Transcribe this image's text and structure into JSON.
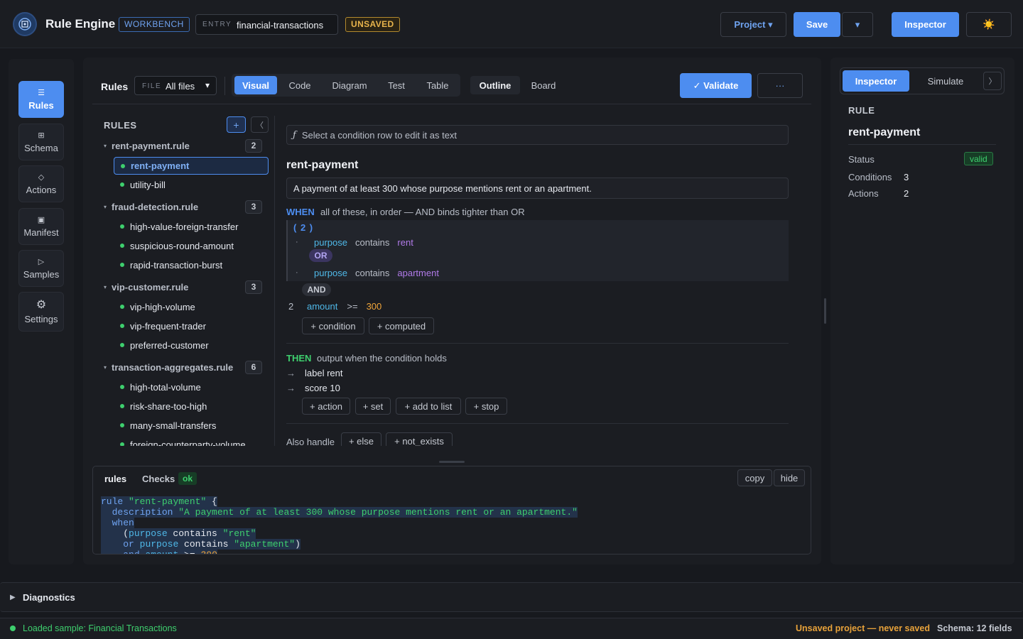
{
  "header": {
    "app_title": "Rule Engine",
    "workbench_badge": "WORKBENCH",
    "entry_label": "ENTRY",
    "entry_value": "financial-transactions",
    "unsaved_badge": "UNSAVED",
    "project_label": "Project ▾",
    "save_label": "Save",
    "save_menu_label": "▾",
    "inspector_label": "Inspector",
    "theme_icon": "☀️"
  },
  "nav": [
    {
      "icon": "☰",
      "label": "Rules"
    },
    {
      "icon": "⊞",
      "label": "Schema"
    },
    {
      "icon": "◇",
      "label": "Actions"
    },
    {
      "icon": "▣",
      "label": "Manifest"
    },
    {
      "icon": "▷",
      "label": "Samples"
    },
    {
      "icon": "⚙",
      "label": "Settings"
    }
  ],
  "toolbar": {
    "rules_label": "Rules",
    "file_label": "FILE",
    "file_value": "All files",
    "file_caret": "▾",
    "view_tabs": [
      "Visual",
      "Code",
      "Diagram",
      "Test",
      "Table"
    ],
    "layout_tabs": [
      "Outline",
      "Board"
    ],
    "validate_label": "✓ Validate",
    "more_label": "···"
  },
  "tree": {
    "title": "RULES",
    "add_label": "+",
    "collapse_label": "〈",
    "files": [
      {
        "name": "rent-payment.rule",
        "count": "2",
        "rules": [
          "rent-payment",
          "utility-bill"
        ]
      },
      {
        "name": "fraud-detection.rule",
        "count": "3",
        "rules": [
          "high-value-foreign-transfer",
          "suspicious-round-amount",
          "rapid-transaction-burst"
        ]
      },
      {
        "name": "vip-customer.rule",
        "count": "3",
        "rules": [
          "vip-high-volume",
          "vip-frequent-trader",
          "preferred-customer"
        ]
      },
      {
        "name": "transaction-aggregates.rule",
        "count": "6",
        "rules": [
          "high-total-volume",
          "risk-share-too-high",
          "many-small-transfers",
          "foreign-counterparty-volume"
        ]
      }
    ]
  },
  "editor": {
    "hint_icon": "ƒ",
    "hint": "Select a condition row to edit it as text",
    "rule_name": "rent-payment",
    "description": "A payment of at least 300 whose purpose mentions rent or an apartment.",
    "when_kw": "WHEN",
    "when_note": "all of these, in order — AND binds tighter than OR",
    "group_label": "( 2 )",
    "group_conditions": [
      {
        "field": "purpose",
        "op": "contains",
        "value": "rent"
      },
      {
        "field": "purpose",
        "op": "contains",
        "value": "apartment"
      }
    ],
    "or_label": "OR",
    "and_label": "AND",
    "cond2": {
      "num": "2",
      "field": "amount",
      "op": ">=",
      "value": "300"
    },
    "add_condition": "+ condition",
    "add_computed": "+ computed",
    "then_kw": "THEN",
    "then_note": "output when the condition holds",
    "actions": [
      {
        "arrow": "→",
        "text": "label rent"
      },
      {
        "arrow": "→",
        "text": "score 10"
      }
    ],
    "action_chips": [
      "+ action",
      "+ set",
      "+ add to list",
      "+ stop"
    ],
    "also_label": "Also handle",
    "also_chips": [
      "+ else",
      "+ not_exists"
    ]
  },
  "code_panel": {
    "tab_rules": "rules",
    "tab_checks": "Checks",
    "checks_badge": "ok",
    "copy_label": "copy",
    "hide_label": "hide"
  },
  "inspector": {
    "tab_inspector": "Inspector",
    "tab_simulate": "Simulate",
    "chevron": "〉",
    "section_label": "RULE",
    "rule_name": "rent-payment",
    "status_key": "Status",
    "status_val": "valid",
    "conditions_key": "Conditions",
    "conditions_val": "3",
    "actions_key": "Actions",
    "actions_val": "2"
  },
  "diagnostics": {
    "label": "Diagnostics",
    "icon": "▶"
  },
  "status_bar": {
    "message": "Loaded sample: Financial Transactions",
    "unsaved": "Unsaved project — never saved",
    "schema": "Schema: 12 fields"
  },
  "colors": {
    "accent": "#4d8df0",
    "success": "#3ecf6e",
    "warning": "#e8b44c",
    "background": "#17191e"
  }
}
